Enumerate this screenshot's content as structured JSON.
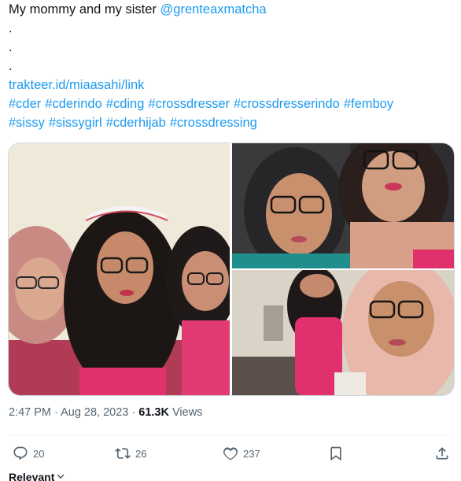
{
  "tweet": {
    "text_prefix": "My mommy and my sister ",
    "mention": "@grenteaxmatcha",
    "dots": [
      ".",
      ".",
      "."
    ],
    "link": "trakteer.id/miaasahi/link",
    "hashtags_line1": [
      "#cder",
      "#cderindo",
      "#cding",
      "#crossdresser",
      "#crossdresserindo",
      "#femboy"
    ],
    "hashtags_line2": [
      "#sissy",
      "#sissygirl",
      "#cderhijab",
      "#crossdressing"
    ]
  },
  "meta": {
    "time": "2:47 PM",
    "separator1": " · ",
    "date": "Aug 28, 2023",
    "separator2": " · ",
    "views_count": "61.3K",
    "views_label": " Views"
  },
  "actions": {
    "replies": "20",
    "retweets": "26",
    "likes": "237"
  },
  "sort": {
    "label": "Relevant"
  },
  "colors": {
    "link": "#1d9bf0",
    "text": "#0f1419",
    "muted": "#536471",
    "border": "#cfd9de"
  },
  "icons": [
    "reply-icon",
    "retweet-icon",
    "like-icon",
    "bookmark-icon",
    "share-icon",
    "chevron-down-icon"
  ]
}
